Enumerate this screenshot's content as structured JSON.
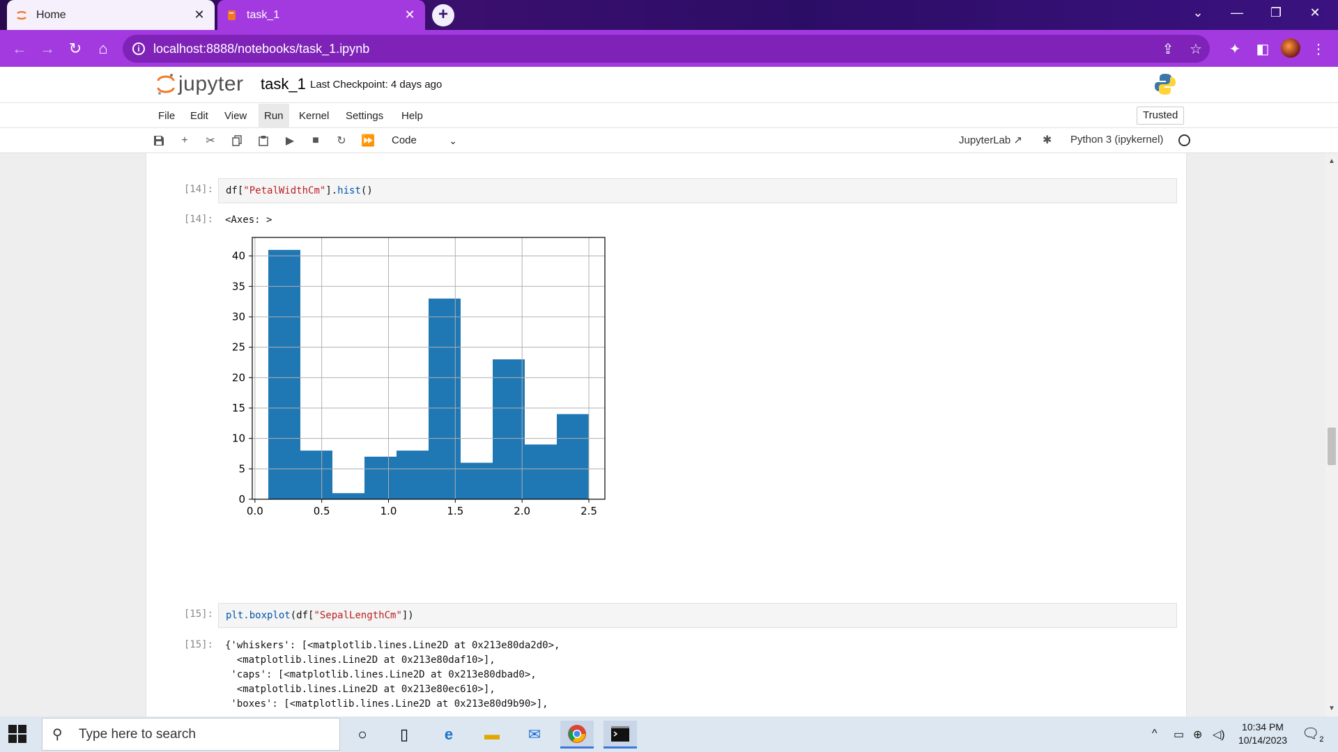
{
  "browser": {
    "tabs": [
      {
        "title": "Home"
      },
      {
        "title": "task_1"
      }
    ],
    "url": "localhost:8888/notebooks/task_1.ipynb"
  },
  "jupyter": {
    "logo_text": "jupyter",
    "notebook_name": "task_1",
    "checkpoint": "Last Checkpoint: 4 days ago",
    "menus": [
      "File",
      "Edit",
      "View",
      "Run",
      "Kernel",
      "Settings",
      "Help"
    ],
    "active_menu": "Run",
    "trusted": "Trusted",
    "cell_type": "Code",
    "jupyterlab_link": "JupyterLab",
    "kernel": "Python 3 (ipykernel)"
  },
  "cells": {
    "c14": {
      "in_prompt": "[14]:",
      "code_prefix": "df[",
      "code_string": "\"PetalWidthCm\"",
      "code_mid": "].",
      "code_fn": "hist",
      "code_suffix": "()",
      "out_prompt": "[14]:",
      "out_text": "<Axes: >"
    },
    "c15": {
      "in_prompt": "[15]:",
      "code_fn": "plt.boxplot",
      "code_prefix": "(df[",
      "code_string": "\"SepalLengthCm\"",
      "code_suffix": "])",
      "out_prompt": "[15]:",
      "out_lines": [
        "{'whiskers': [<matplotlib.lines.Line2D at 0x213e80da2d0>,",
        "  <matplotlib.lines.Line2D at 0x213e80daf10>],",
        " 'caps': [<matplotlib.lines.Line2D at 0x213e80dbad0>,",
        "  <matplotlib.lines.Line2D at 0x213e80ec610>],",
        " 'boxes': [<matplotlib.lines.Line2D at 0x213e80d9b90>],"
      ]
    }
  },
  "chart_data": {
    "type": "bar",
    "title": "",
    "xlabel": "",
    "ylabel": "",
    "bins": [
      [
        0.1,
        0.34
      ],
      [
        0.34,
        0.58
      ],
      [
        0.58,
        0.82
      ],
      [
        0.82,
        1.06
      ],
      [
        1.06,
        1.3
      ],
      [
        1.3,
        1.54
      ],
      [
        1.54,
        1.78
      ],
      [
        1.78,
        2.02
      ],
      [
        2.02,
        2.26
      ],
      [
        2.26,
        2.5
      ]
    ],
    "values": [
      41,
      8,
      1,
      7,
      8,
      33,
      6,
      23,
      9,
      14
    ],
    "xlim": [
      -0.02,
      2.62
    ],
    "ylim": [
      0,
      43.05
    ],
    "xticks": [
      "0.0",
      "0.5",
      "1.0",
      "1.5",
      "2.0",
      "2.5"
    ],
    "yticks": [
      "0",
      "5",
      "10",
      "15",
      "20",
      "25",
      "30",
      "35",
      "40"
    ],
    "grid": true,
    "bar_color": "#1f77b4"
  },
  "taskbar": {
    "search_placeholder": "Type here to search",
    "time": "10:34 PM",
    "date": "10/14/2023",
    "notification_count": "2"
  }
}
